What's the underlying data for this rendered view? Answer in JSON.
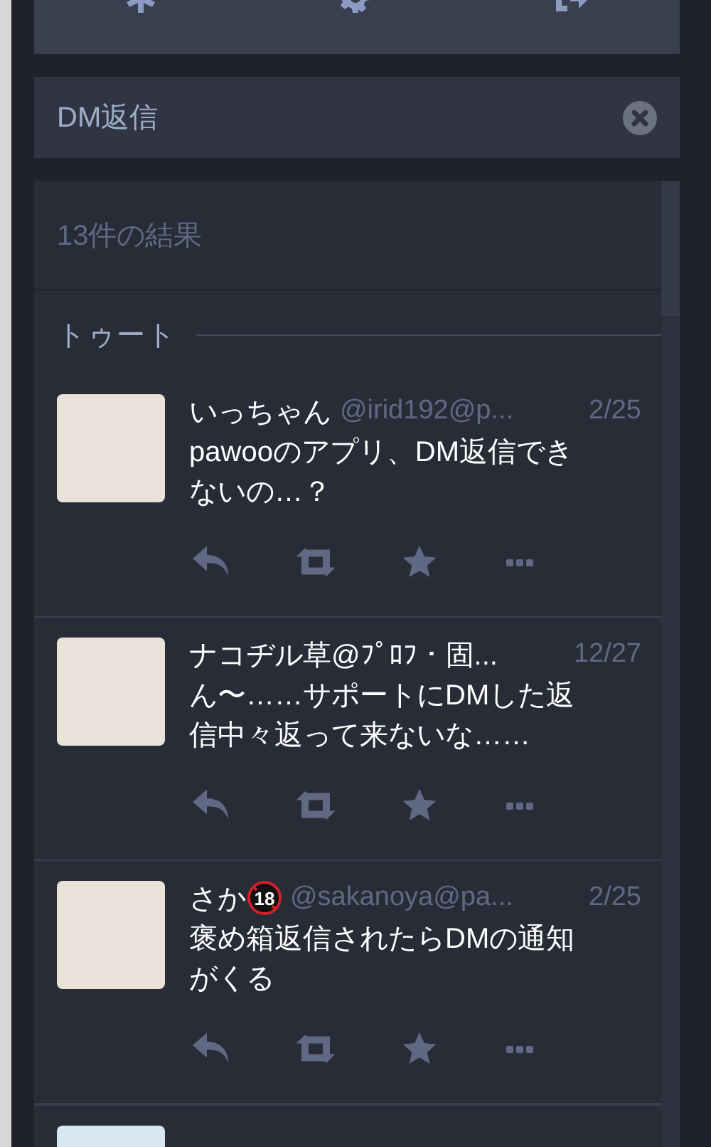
{
  "search": {
    "value": "DM返信"
  },
  "results": {
    "count": "13件の結果",
    "section": "トゥート"
  },
  "posts": [
    {
      "display_name": "いっちゃん",
      "handle": "@irid192@p...",
      "date": "2/25",
      "content": "pawooのアプリ、DM返信できないの…？"
    },
    {
      "display_name": "ナコヂル草@ﾌﾟﾛﾌ・固...",
      "date": "12/27",
      "content": "ん〜……サポートにDMした返信中々返って来ないな……"
    },
    {
      "display_name": "さか",
      "badge": "18",
      "handle": "@sakanoya@pa...",
      "date": "2/25",
      "content": "褒め箱返信されたらDMの通知がくる"
    }
  ]
}
